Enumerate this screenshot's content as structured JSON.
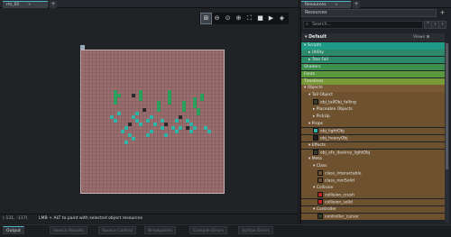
{
  "room_tab": {
    "label": "rm_01",
    "close": "×"
  },
  "resources_tab": {
    "label": "Resources",
    "close": "×"
  },
  "toolbar": {
    "icons": [
      "⊞",
      "⊖",
      "⊙",
      "⊕",
      "⛶",
      "■",
      "▶",
      "◈"
    ]
  },
  "resources": {
    "dropdown": "Resources",
    "search_placeholder": "Search...",
    "default_label": "Default",
    "views_label": "Views",
    "rows": [
      {
        "text": "▾ Scripts",
        "indent": 0,
        "bg": "#1e9a86"
      },
      {
        "text": "▸ Utility",
        "indent": 1,
        "bg": "#2c8a6a"
      },
      {
        "text": "▸ Tree Fall",
        "indent": 1,
        "bg": "#2c8a6a"
      },
      {
        "text": "Shaders",
        "indent": 0,
        "bg": "#3c8f4c"
      },
      {
        "text": "Fonts",
        "indent": 0,
        "bg": "#5a9a3c"
      },
      {
        "text": "Timelines",
        "indent": 0,
        "bg": "#7a9a38"
      },
      {
        "text": "▾ Objects",
        "indent": 0,
        "bg": "#7a5a34"
      },
      {
        "text": "▾ Tall Object",
        "indent": 1,
        "bg": "#6e5230"
      },
      {
        "text": "obj_tallObj_falling",
        "indent": 2,
        "bg": "#6e5230",
        "swatch": "#3a3f2a"
      },
      {
        "text": "▸ Placeable Objects",
        "indent": 2,
        "bg": "#6e5230"
      },
      {
        "text": "▸ PickUp",
        "indent": 2,
        "bg": "#6e5230"
      },
      {
        "text": "▾ Props",
        "indent": 1,
        "bg": "#6e5230"
      },
      {
        "text": "obj_lightObj",
        "indent": 2,
        "bg": "#6e5230",
        "swatch": "#2fb3a8"
      },
      {
        "text": "obj_heavyObj",
        "indent": 2,
        "bg": "#6e5230",
        "swatch": "#222"
      },
      {
        "text": "▾ Effects",
        "indent": 1,
        "bg": "#6e5230"
      },
      {
        "text": "obj_efx_destroy_lightObj",
        "indent": 2,
        "bg": "#6e5230",
        "swatch": "#3a3f2a"
      },
      {
        "text": "▾ Meta",
        "indent": 1,
        "bg": "#6e5230"
      },
      {
        "text": "▾ Class",
        "indent": 2,
        "bg": "#6e5230"
      },
      {
        "text": "class_interactable",
        "indent": 3,
        "bg": "#6e5230",
        "swatch": "#6e5230"
      },
      {
        "text": "class_nonSolid",
        "indent": 3,
        "bg": "#6e5230",
        "swatch": "#6e5230"
      },
      {
        "text": "▾ Collision",
        "indent": 2,
        "bg": "#6e5230"
      },
      {
        "text": "collision_crush",
        "indent": 3,
        "bg": "#6e5230",
        "swatch": "#c0281f"
      },
      {
        "text": "collision_solid",
        "indent": 3,
        "bg": "#6e5230",
        "swatch": "#c0281f"
      },
      {
        "text": "▾ Controller",
        "indent": 2,
        "bg": "#6e5230"
      },
      {
        "text": "controller_cursor",
        "indent": 3,
        "bg": "#6e5230",
        "swatch": "#3a3f2a"
      }
    ]
  },
  "status": {
    "coords": "(-131, -117)",
    "hint": "LMB + ALT to paint with selected object resources"
  },
  "bottom_tabs": [
    "Output",
    "Search Results",
    "Source Control",
    "Breakpoints",
    "Compile Errors",
    "Syntax Errors"
  ],
  "colors": {
    "room": "#9a6e6e",
    "green_obj": "#2a9e5a",
    "teal_obj": "#2fb3a8",
    "dark_obj": "#2a2a2a",
    "accent": "#4fb3c9"
  }
}
